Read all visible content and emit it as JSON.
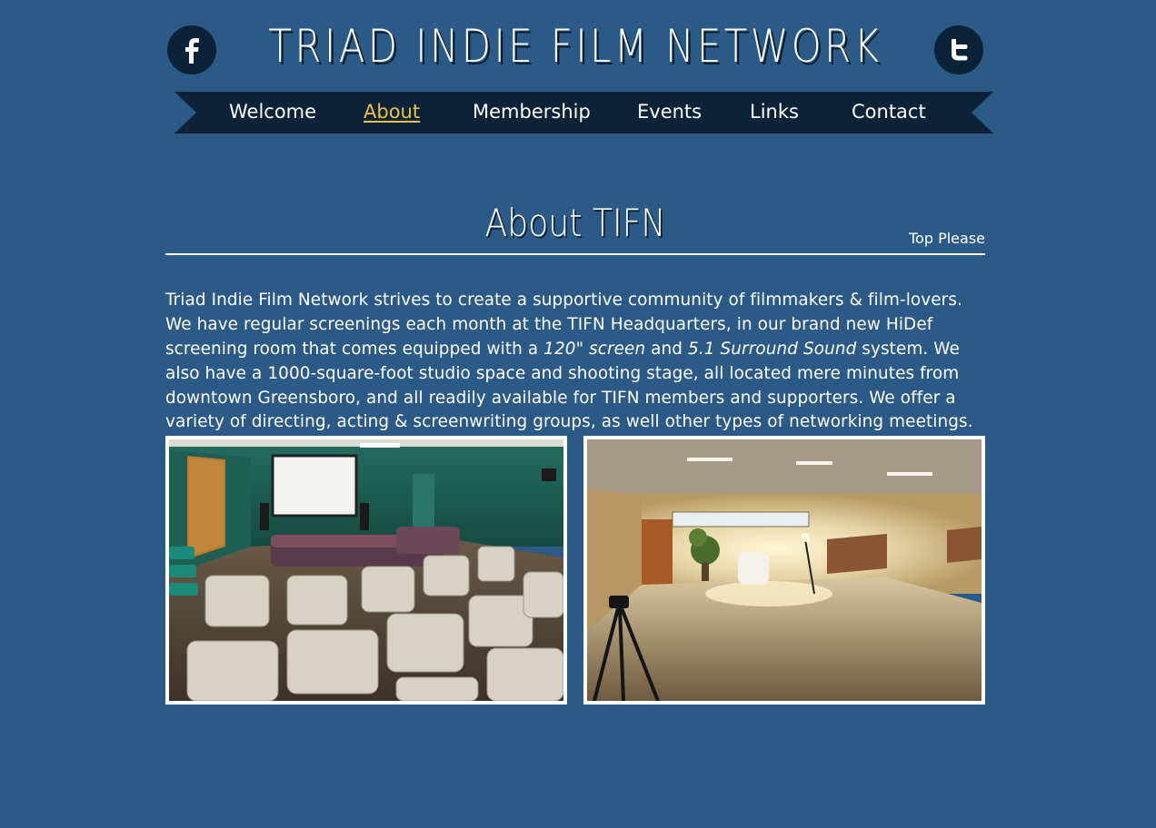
{
  "header": {
    "title": "TRIAD INDIE FILM NETWORK",
    "facebook_icon": "facebook-icon",
    "twitter_icon": "twitter-icon"
  },
  "nav": {
    "items": [
      {
        "label": "Welcome",
        "active": false
      },
      {
        "label": "About",
        "active": true
      },
      {
        "label": "Membership",
        "active": false
      },
      {
        "label": "Events",
        "active": false
      },
      {
        "label": "Links",
        "active": false
      },
      {
        "label": "Contact",
        "active": false
      }
    ]
  },
  "section": {
    "title": "About TIFN",
    "top_link": "Top Please"
  },
  "intro": {
    "part1": "Triad Indie Film Network strives to create a supportive community of filmmakers & film-lovers. We have regular screenings each month at the TIFN Headquarters, in our brand new HiDef screening room that comes equipped with a ",
    "em1": "120\" screen",
    "part2": " and ",
    "em2": "5.1 Surround Sound",
    "part3": " system. We also have a 1000-square-foot studio space and shooting stage, all located mere minutes from downtown Greensboro, and all readily available for TIFN members and supporters. We offer a variety of directing, acting & screenwriting groups, as well other types of networking meetings."
  },
  "colors": {
    "background": "#2a5a85",
    "nav_ribbon": "#0b2238",
    "active_nav": "#e8c447",
    "text": "#ffffff"
  }
}
